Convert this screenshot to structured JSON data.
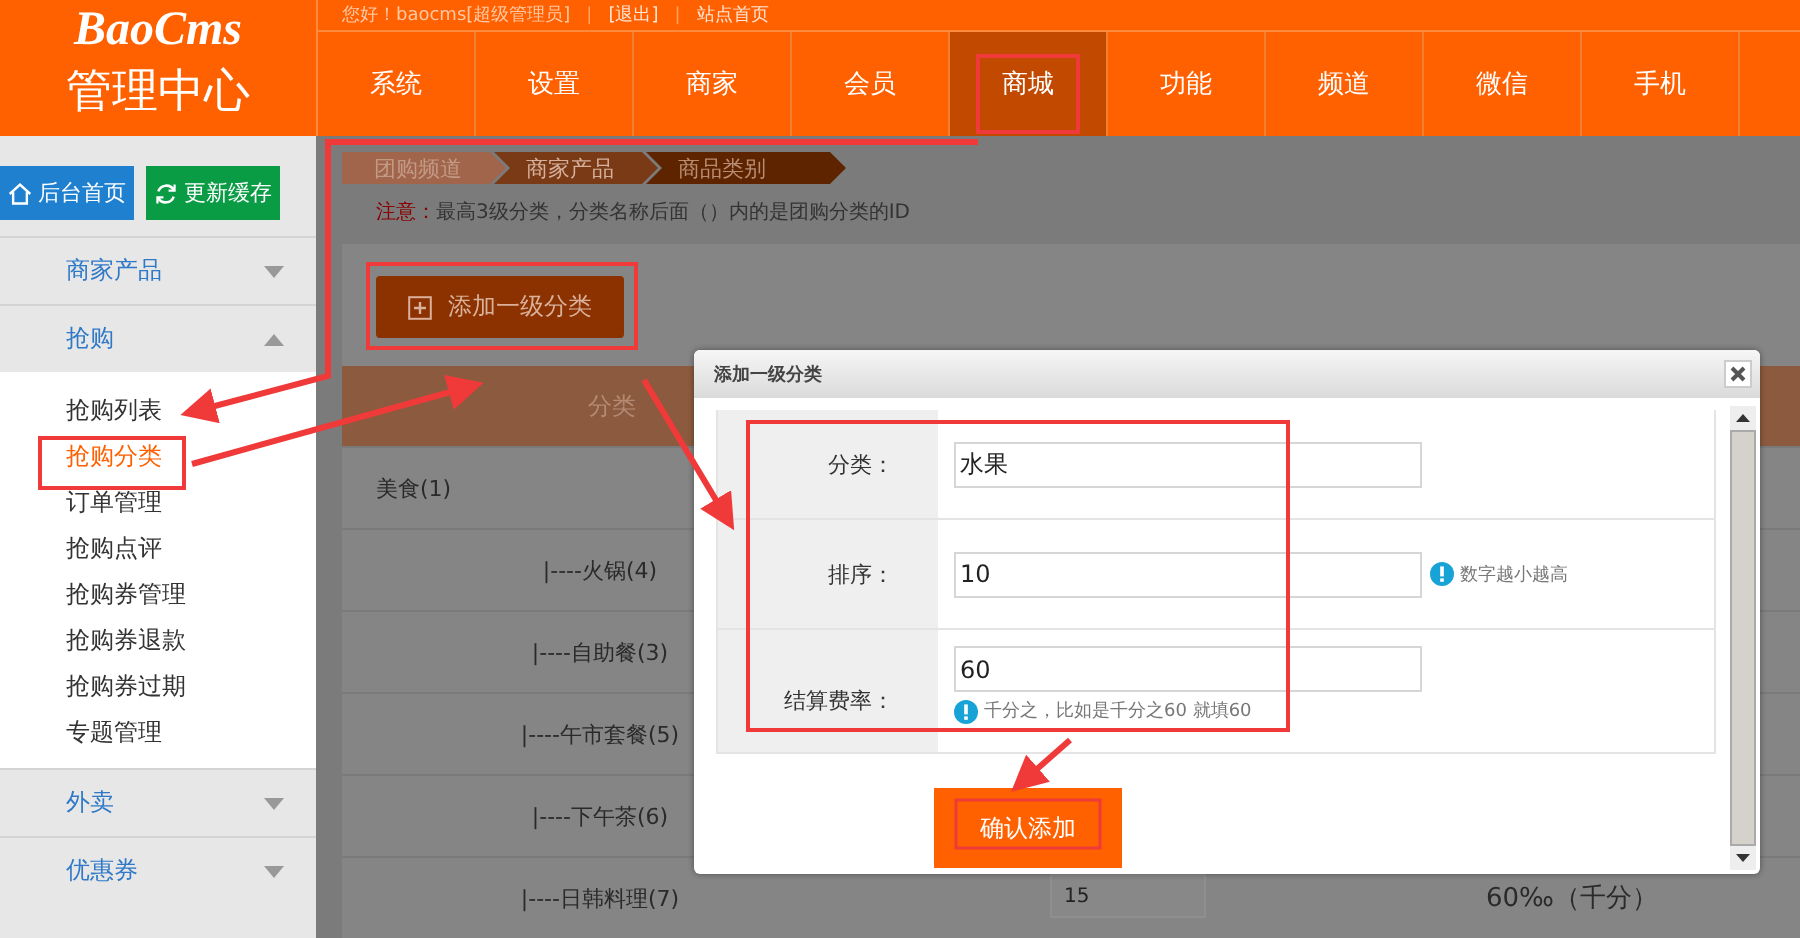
{
  "header": {
    "logo": "BaoCms",
    "title": "管理中心",
    "strip": [
      {
        "kind": "text",
        "text": "您好！baocms[超级管理员]"
      },
      {
        "kind": "separator",
        "text": "|"
      },
      {
        "kind": "link",
        "text": "[退出]"
      },
      {
        "kind": "separator",
        "text": "|"
      },
      {
        "kind": "link",
        "text": "站点首页"
      }
    ]
  },
  "nav_tabs": [
    {
      "label": "系统",
      "selected": false
    },
    {
      "label": "设置",
      "selected": false
    },
    {
      "label": "商家",
      "selected": false
    },
    {
      "label": "会员",
      "selected": false
    },
    {
      "label": "商城",
      "selected": true
    },
    {
      "label": "功能",
      "selected": false
    },
    {
      "label": "频道",
      "selected": false
    },
    {
      "label": "微信",
      "selected": false
    },
    {
      "label": "手机",
      "selected": false
    }
  ],
  "sidebar": {
    "home_button": "后台首页",
    "refresh_button": "更新缓存",
    "groups": [
      {
        "label": "商家产品",
        "expanded": false
      },
      {
        "label": "抢购",
        "expanded": true,
        "children": [
          {
            "label": "抢购列表",
            "selected": false
          },
          {
            "label": "抢购分类",
            "selected": true
          },
          {
            "label": "订单管理",
            "selected": false
          },
          {
            "label": "抢购点评",
            "selected": false
          },
          {
            "label": "抢购券管理",
            "selected": false
          },
          {
            "label": "抢购券退款",
            "selected": false
          },
          {
            "label": "抢购券过期",
            "selected": false
          },
          {
            "label": "专题管理",
            "selected": false
          }
        ]
      },
      {
        "label": "外卖",
        "expanded": false
      },
      {
        "label": "优惠券",
        "expanded": false
      }
    ]
  },
  "breadcrumb": [
    "团购频道",
    "商家产品",
    "商品类别"
  ],
  "notice": {
    "label": "注意：",
    "text": "最高3级分类，分类名称后面（）内的是团购分类的ID"
  },
  "add_button": "添加一级分类",
  "table": {
    "columns": [
      "分类"
    ],
    "rows": [
      {
        "name": "美食(1)",
        "children": [
          {
            "name": "|----火锅(4)"
          },
          {
            "name": "|----自助餐(3)"
          },
          {
            "name": "|----午市套餐(5)"
          },
          {
            "name": "|----下午茶(6)"
          },
          {
            "name": "|----日韩料理(7)",
            "sort": "15",
            "rate": "60‰（千分）"
          }
        ]
      }
    ]
  },
  "dialog": {
    "title": "添加一级分类",
    "fields": [
      {
        "kind": "plain",
        "label": "分类：",
        "value": "水果"
      },
      {
        "kind": "side_hint",
        "label": "排序：",
        "value": "10",
        "hint": "数字越小越高"
      },
      {
        "kind": "below_hint",
        "label": "结算费率：",
        "value": "60",
        "hint": "千分之，比如是千分之60 就填60"
      }
    ],
    "submit": "确认添加"
  }
}
